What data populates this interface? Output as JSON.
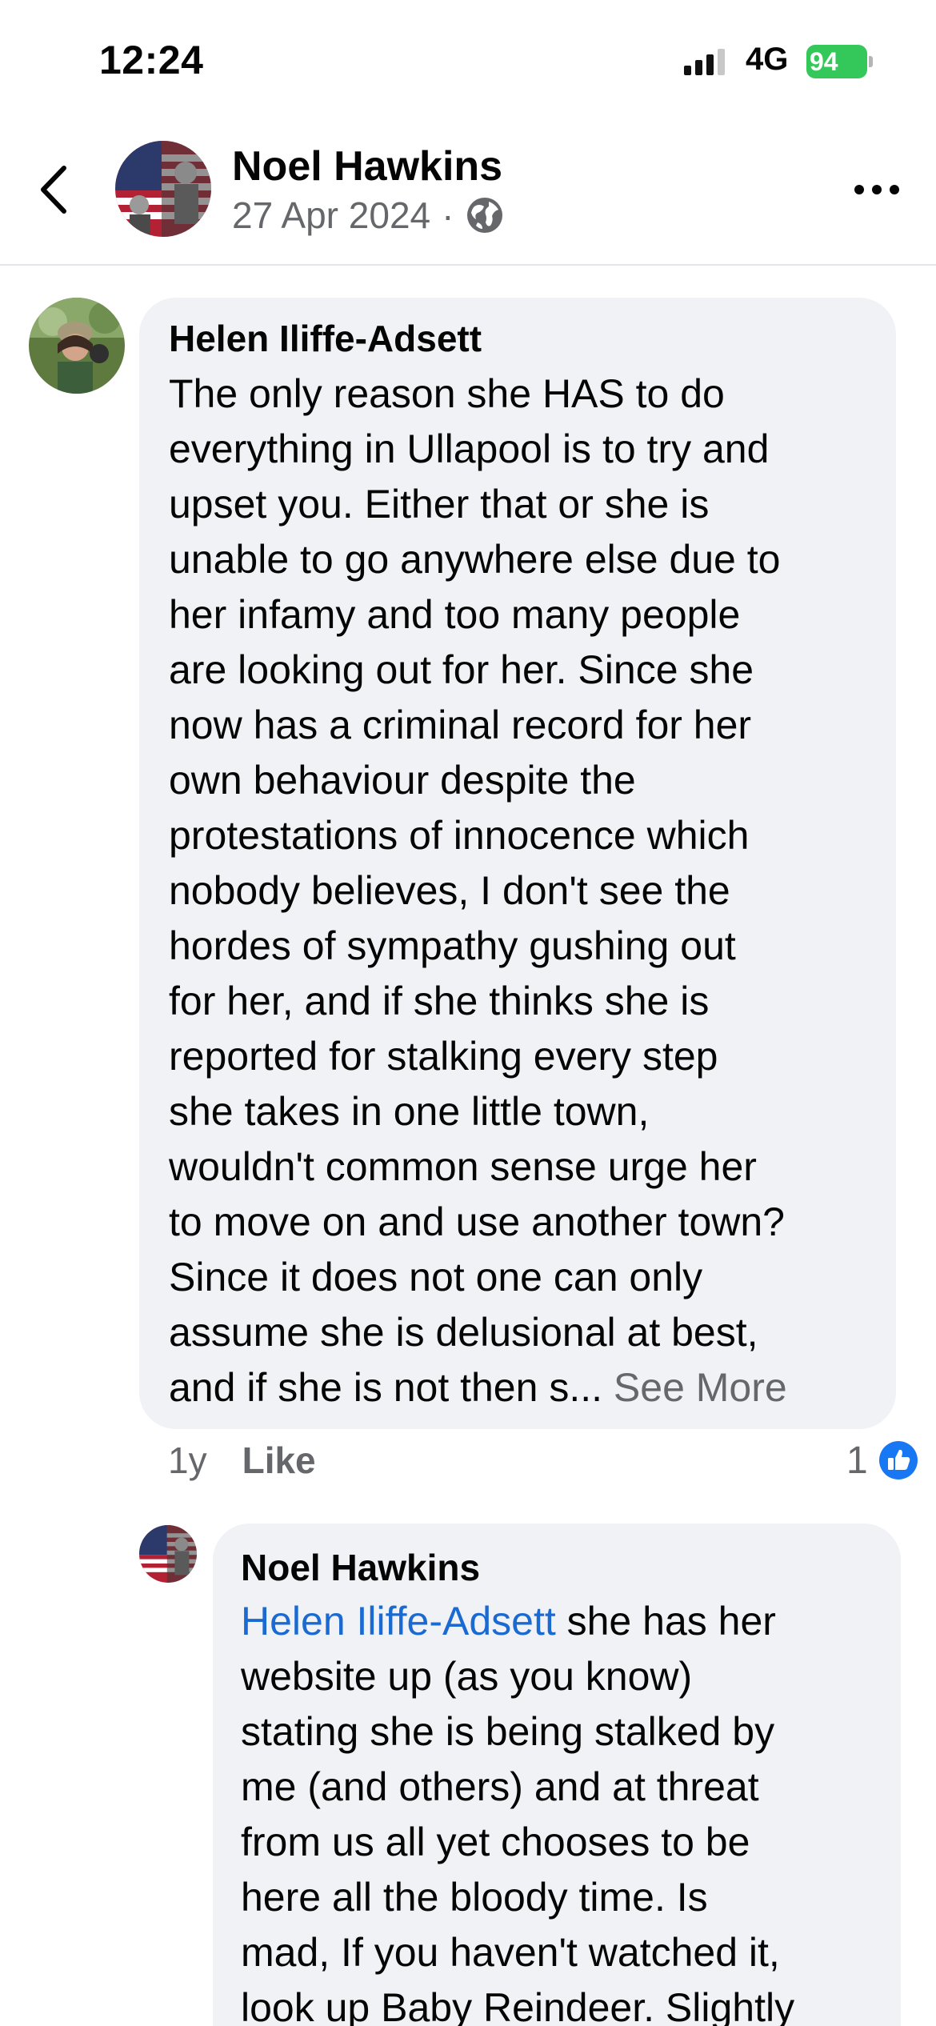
{
  "status_bar": {
    "time": "12:24",
    "network": "4G",
    "battery": "94"
  },
  "header": {
    "name": "Noel Hawkins",
    "date": "27 Apr 2024",
    "separator": "·",
    "privacy_icon": "globe-icon"
  },
  "comment": {
    "author": "Helen Iliffe-Adsett",
    "lines": [
      "The only reason she HAS to do",
      "everything in Ullapool is to try and",
      "upset you. Either that or she is",
      "unable to go anywhere else due to",
      "her infamy and too many people",
      "are looking out for her. Since she",
      "now has a criminal record for her",
      "own behaviour despite the",
      "protestations of innocence which",
      "nobody believes, I don't see the",
      "hordes of sympathy gushing out",
      "for her, and if she thinks she is",
      "reported for stalking every step",
      "she takes in one little town,",
      "wouldn't common sense urge her",
      "to move on and use another town?",
      "Since it does not one can only",
      "assume she is delusional at best,"
    ],
    "last_line": "and if she is not then s...",
    "see_more": "See More",
    "time_ago": "1y",
    "like_label": "Like",
    "reaction_count": "1"
  },
  "reply": {
    "author": "Noel Hawkins",
    "mention": "Helen Iliffe-Adsett",
    "first_line_rest": " she has her",
    "lines": [
      "website up (as you know)",
      "stating she is being stalked by",
      "me (and others) and at threat",
      "from us all yet chooses to be",
      "here all the bloody time. Is",
      "mad, If you haven't watched it,",
      "look up Baby Reindeer. Slightly"
    ]
  },
  "colors": {
    "bubble": "#f0f2f5",
    "secondary_text": "#65676b",
    "mention": "#1b6ad1",
    "like_blue": "#1877f2",
    "battery_green": "#34c759"
  }
}
